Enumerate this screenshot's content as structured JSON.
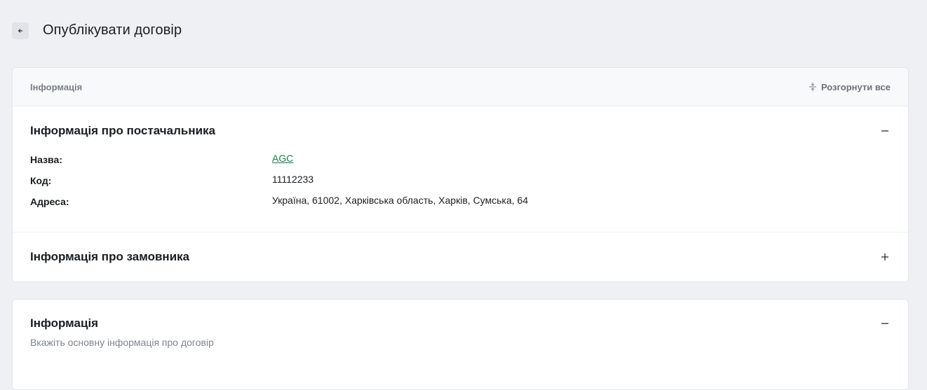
{
  "header": {
    "title": "Опублікувати договір"
  },
  "info_card": {
    "topbar_label": "Інформація",
    "expand_all_label": "Розгорнути все",
    "supplier": {
      "title": "Інформація про постачальника",
      "expanded": true,
      "fields": {
        "name_label": "Назва:",
        "name_value": "AGC",
        "code_label": "Код:",
        "code_value": "11112233",
        "address_label": "Адреса:",
        "address_value": "Україна, 61002, Харківська область, Харків, Сумська, 64"
      }
    },
    "customer": {
      "title": "Інформація про замовника",
      "expanded": false
    }
  },
  "main_info": {
    "title": "Інформація",
    "subtitle": "Вкажіть основну інформація про договір",
    "expanded": true
  },
  "colors": {
    "background": "#eef0f4",
    "link": "#1a7a4c",
    "muted": "#7a7f88"
  },
  "icons": {
    "back": "arrow-left-icon",
    "expand_all": "expand-all-icon",
    "collapse": "minus-icon",
    "expand": "plus-icon"
  }
}
